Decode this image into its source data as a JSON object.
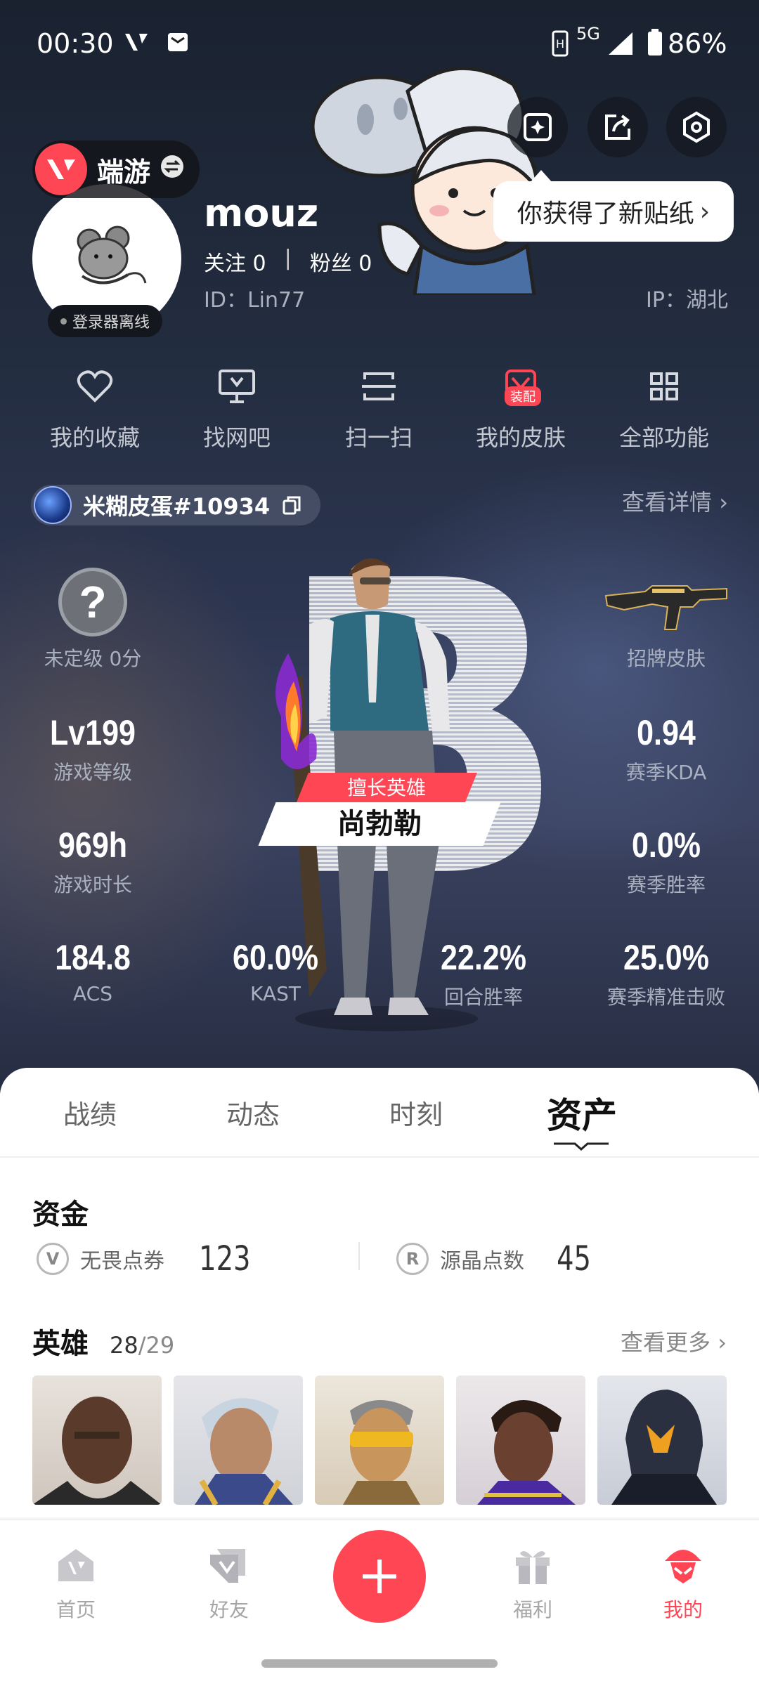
{
  "status_bar": {
    "time": "00:30",
    "network": "5G",
    "battery": "86%"
  },
  "profile": {
    "game_tag": "端游",
    "username": "mouz",
    "follow_label": "关注",
    "follow_count": "0",
    "fans_label": "粉丝",
    "fans_count": "0",
    "id_text": "ID：Lin77",
    "ip_text": "IP：湖北",
    "login_status": "登录器离线",
    "tooltip": "你获得了新贴纸",
    "skin_badge": "装配"
  },
  "functions": [
    {
      "label": "我的收藏",
      "icon": "heart-icon"
    },
    {
      "label": "找网吧",
      "icon": "monitor-icon"
    },
    {
      "label": "扫一扫",
      "icon": "scan-icon"
    },
    {
      "label": "我的皮肤",
      "icon": "skin-icon"
    },
    {
      "label": "全部功能",
      "icon": "grid-icon"
    }
  ],
  "player": {
    "tag": "米糊皮蛋#10934",
    "view_detail": "查看详情"
  },
  "stats": {
    "rank_label": "未定级 0分",
    "signature_skin": "招牌皮肤",
    "level_value": "Lv199",
    "level_label": "游戏等级",
    "kda_value": "0.94",
    "kda_label": "赛季KDA",
    "hours_value": "969h",
    "hours_label": "游戏时长",
    "winrate_value": "0.0%",
    "winrate_label": "赛季胜率",
    "acs_value": "184.8",
    "acs_label": "ACS",
    "kast_value": "60.0%",
    "kast_label": "KAST",
    "round_win_value": "22.2%",
    "round_win_label": "回合胜率",
    "headshot_value": "25.0%",
    "headshot_label": "赛季精准击败",
    "fav_agent_label": "擅长英雄",
    "fav_agent_name": "尚勃勒"
  },
  "tabs": [
    "战绩",
    "动态",
    "时刻",
    "资产"
  ],
  "assets": {
    "funds_title": "资金",
    "vp_label": "无畏点券",
    "vp_value": "123",
    "rp_label": "源晶点数",
    "rp_value": "45",
    "heroes_title": "英雄",
    "heroes_owned": "28",
    "heroes_total": "/29",
    "see_more": "查看更多"
  },
  "nav": [
    {
      "label": "首页",
      "icon": "home-icon"
    },
    {
      "label": "好友",
      "icon": "friends-icon"
    },
    {
      "label": "福利",
      "icon": "gift-icon"
    },
    {
      "label": "我的",
      "icon": "profile-icon"
    }
  ],
  "colors": {
    "accent": "#ff4655",
    "hero_bg": "#222c3e"
  }
}
